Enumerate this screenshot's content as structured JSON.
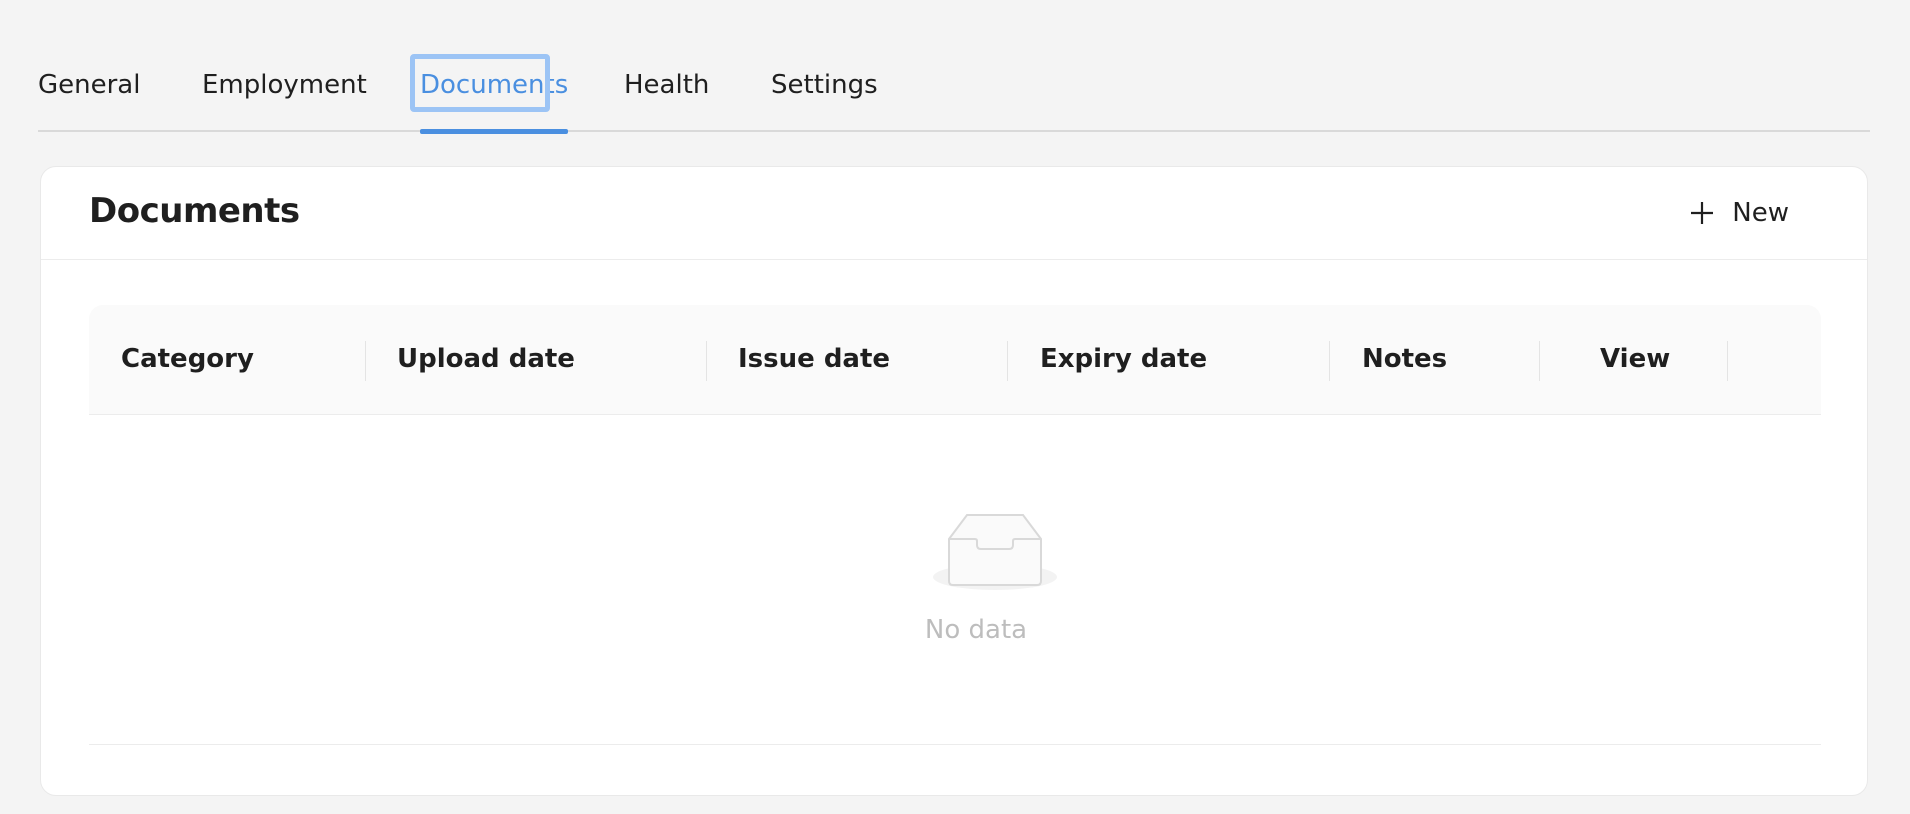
{
  "tabs": {
    "items": [
      {
        "label": "General"
      },
      {
        "label": "Employment"
      },
      {
        "label": "Documents"
      },
      {
        "label": "Health"
      },
      {
        "label": "Settings"
      }
    ],
    "active_index": 2
  },
  "card": {
    "title": "Documents",
    "new_button_label": "New"
  },
  "table": {
    "columns": [
      "Category",
      "Upload date",
      "Issue date",
      "Expiry date",
      "Notes",
      "View"
    ],
    "rows": [],
    "empty_text": "No data"
  },
  "icons": {
    "new": "plus-icon",
    "empty": "inbox-empty-icon"
  },
  "colors": {
    "accent": "#4a8fe0",
    "focus_ring": "#9cc4f5",
    "background": "#f4f4f4"
  }
}
